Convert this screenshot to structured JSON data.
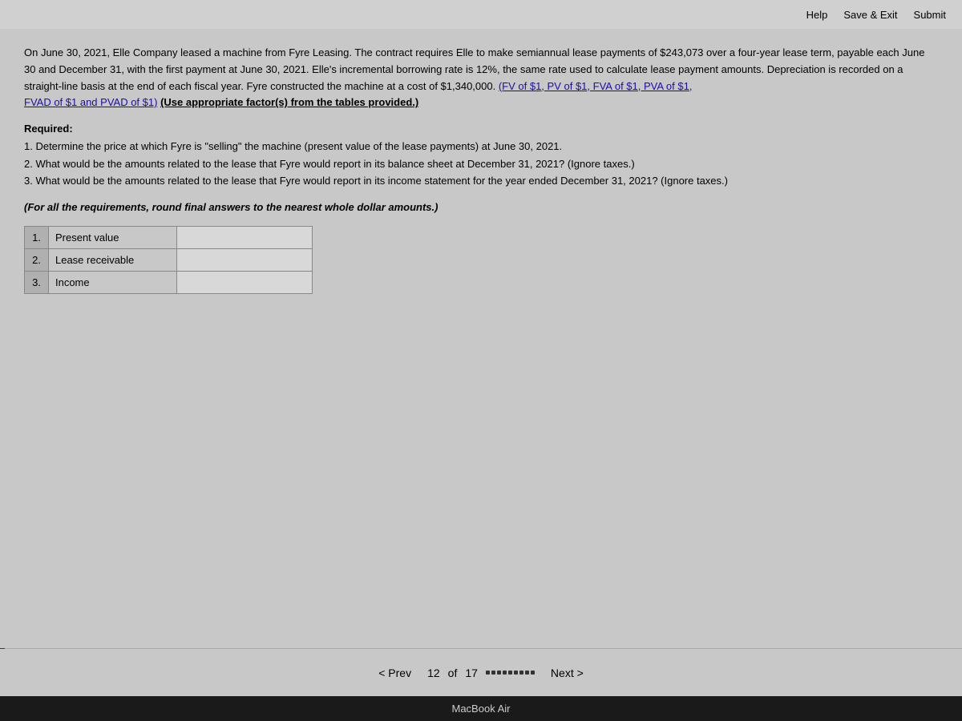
{
  "topbar": {
    "help_label": "Help",
    "save_exit_label": "Save & Exit",
    "submit_label": "Submit"
  },
  "question": {
    "paragraph": "On June 30, 2021, Elle Company leased a machine from Fyre Leasing. The contract requires Elle to make semiannual lease payments of $243,073 over a four-year lease term, payable each June 30 and December 31, with the first payment at June 30, 2021. Elle's incremental borrowing rate is 12%, the same rate used to calculate lease payment amounts. Depreciation is recorded on a straight-line basis at the end of each fiscal year. Fyre constructed the machine at a cost of $1,340,000.",
    "links_text": "(FV of $1, PV of $1, FVA of $1, PVA of $1, FVAD of $1 and PVAD of $1)",
    "bold_instruction": "(Use appropriate factor(s) from the tables provided.)",
    "required_title": "Required:",
    "items": [
      "1. Determine the price at which Fyre is \"selling\" the machine (present value of the lease payments) at June 30, 2021.",
      "2. What would be the amounts related to the lease that Fyre would report in its balance sheet at December 31, 2021? (Ignore taxes.)",
      "3. What would be the amounts related to the lease that Fyre would report in its income statement for the year ended December 31, 2021? (Ignore taxes.)"
    ],
    "for_all_note": "(For all the requirements, round final answers to the nearest whole dollar amounts.)"
  },
  "table": {
    "rows": [
      {
        "num": "1.",
        "label": "Present value",
        "input": ""
      },
      {
        "num": "2.",
        "label": "Lease receivable",
        "input": ""
      },
      {
        "num": "3.",
        "label": "Income",
        "input": ""
      }
    ]
  },
  "navigation": {
    "prev_label": "< Prev",
    "page_current": "12",
    "page_total": "17",
    "page_text": "of",
    "next_label": "Next >"
  },
  "macbook": {
    "label": "MacBook Air"
  }
}
